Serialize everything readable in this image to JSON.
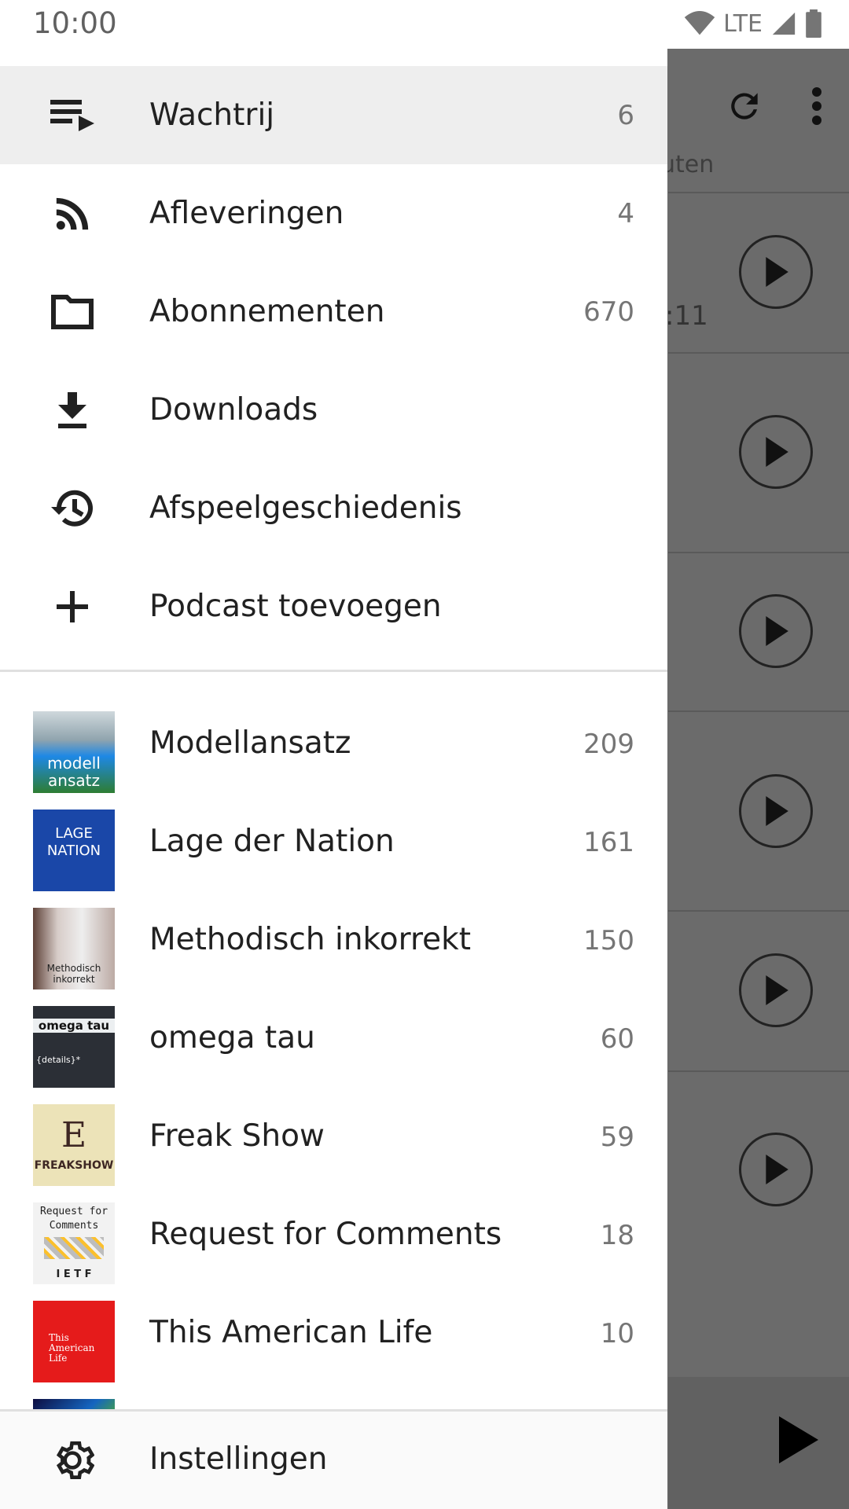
{
  "status_bar": {
    "time": "10:00",
    "network": "LTE",
    "icons": [
      "wifi-icon",
      "signal-icon",
      "battery-icon"
    ]
  },
  "drawer": {
    "nav_items": [
      {
        "label": "Wachtrij",
        "count": "6",
        "icon": "queue-icon",
        "selected": true
      },
      {
        "label": "Afleveringen",
        "count": "4",
        "icon": "rss-icon"
      },
      {
        "label": "Abonnementen",
        "count": "670",
        "icon": "folder-icon"
      },
      {
        "label": "Downloads",
        "count": "",
        "icon": "download-icon"
      },
      {
        "label": "Afspeelgeschiedenis",
        "count": "",
        "icon": "history-icon"
      },
      {
        "label": "Podcast toevoegen",
        "count": "",
        "icon": "add-icon"
      }
    ],
    "subscriptions": [
      {
        "label": "Modellansatz",
        "count": "209",
        "thumb_text": [
          "modell",
          "ansatz"
        ]
      },
      {
        "label": "Lage der Nation",
        "count": "161",
        "thumb_text": [
          "LAGE",
          "NATION"
        ]
      },
      {
        "label": "Methodisch inkorrekt",
        "count": "150",
        "thumb_text": [
          "Methodisch",
          "inkorrekt"
        ]
      },
      {
        "label": "omega tau",
        "count": "60",
        "thumb_text": [
          "omega tau",
          "{details}*"
        ]
      },
      {
        "label": "Freak Show",
        "count": "59",
        "thumb_text": [
          "FREAKSHOW"
        ]
      },
      {
        "label": "Request for Comments",
        "count": "18",
        "thumb_text": [
          "Request for",
          "Comments",
          "I E T F"
        ]
      },
      {
        "label": "This American Life",
        "count": "10",
        "thumb_text": [
          "This",
          "American",
          "Life"
        ]
      }
    ],
    "footer": {
      "label": "Instellingen",
      "icon": "gear-icon"
    }
  },
  "background": {
    "subtitle_fragment": "uten",
    "time_fragment": ":11",
    "toolbar_icons": [
      "refresh-icon",
      "more-vert-icon"
    ]
  }
}
